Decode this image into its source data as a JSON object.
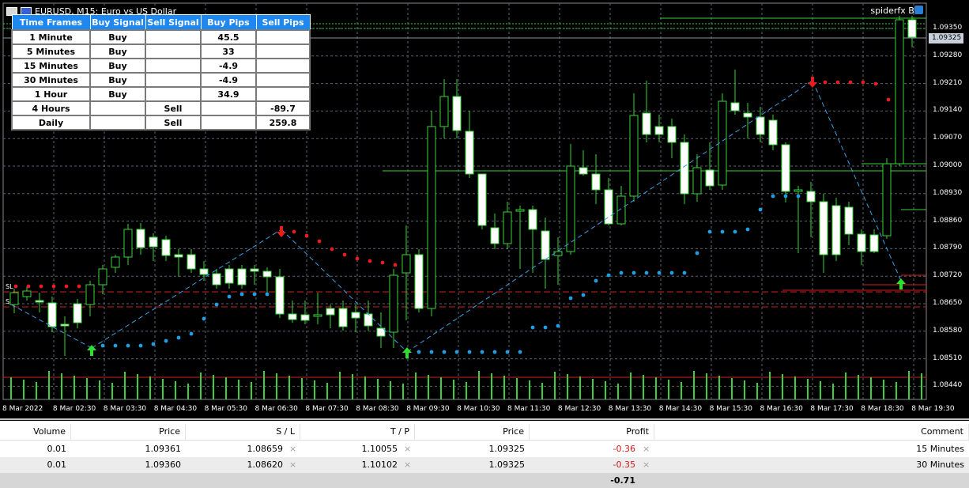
{
  "window": {
    "title": "EURUSD, M15:  Euro vs US Dollar",
    "user": "spiderfx BV",
    "icons": [
      "table-icon",
      "flag-icon",
      "user-icon"
    ]
  },
  "signal_table": {
    "headers": [
      "Time Frames",
      "Buy Signal",
      "Sell Signal",
      "Buy Pips",
      "Sell Pips"
    ],
    "rows": [
      [
        "1 Minute",
        "Buy",
        "",
        "45.5",
        ""
      ],
      [
        "5 Minutes",
        "Buy",
        "",
        "33",
        ""
      ],
      [
        "15 Minutes",
        "Buy",
        "",
        "-4.9",
        ""
      ],
      [
        "30 Minutes",
        "Buy",
        "",
        "-4.9",
        ""
      ],
      [
        "1 Hour",
        "Buy",
        "",
        "34.9",
        ""
      ],
      [
        "4 Hours",
        "",
        "Sell",
        "",
        "-89.7"
      ],
      [
        "Daily",
        "",
        "Sell",
        "",
        "259.8"
      ]
    ]
  },
  "chart_data": {
    "type": "candlestick",
    "symbol": "EURUSD",
    "timeframe": "M15",
    "ylim": [
      1.084,
      1.097
    ],
    "price_ticks": [
      "1.09350",
      "1.09280",
      "1.09210",
      "1.09140",
      "1.09070",
      "1.09000",
      "1.08930",
      "1.08860",
      "1.08790",
      "1.08720",
      "1.08650",
      "1.08580",
      "1.08510",
      "1.08440"
    ],
    "current_price": "1.09325",
    "time_ticks": [
      "8 Mar 2022",
      "8 Mar 02:30",
      "8 Mar 03:30",
      "8 Mar 04:30",
      "8 Mar 05:30",
      "8 Mar 06:30",
      "8 Mar 07:30",
      "8 Mar 08:30",
      "8 Mar 09:30",
      "8 Mar 10:30",
      "8 Mar 11:30",
      "8 Mar 12:30",
      "8 Mar 13:30",
      "8 Mar 14:30",
      "8 Mar 15:30",
      "8 Mar 16:30",
      "8 Mar 17:30",
      "8 Mar 18:30",
      "8 Mar 19:30"
    ],
    "markers": [
      "SL",
      "S"
    ],
    "colors": {
      "background": "#000000",
      "candle_outline": "#39d339",
      "bull_body": "#000000",
      "bear_body": "#ffffff",
      "grid": "#5a6270",
      "volume": "#39d339",
      "trend_dots_up": "#1ea0e6",
      "trend_dots_down": "#e61e1e",
      "signal_up": "#2ee02e",
      "signal_down": "#e61e1e",
      "trade_line": "#3aa0e6",
      "level_green": "#3cd03c",
      "level_red": "#d01e1e"
    }
  },
  "trade_panel": {
    "headers": {
      "volume": "Volume",
      "price": "Price",
      "sl": "S / L",
      "tp": "T / P",
      "current": "Price",
      "profit": "Profit",
      "comment": "Comment"
    },
    "rows": [
      {
        "volume": "0.01",
        "price": "1.09361",
        "sl": "1.08659",
        "tp": "1.10055",
        "current": "1.09325",
        "profit": "-0.36",
        "comment": "15 Minutes"
      },
      {
        "volume": "0.01",
        "price": "1.09360",
        "sl": "1.08620",
        "tp": "1.10102",
        "current": "1.09325",
        "profit": "-0.35",
        "comment": "30 Minutes"
      }
    ],
    "total_profit": "-0.71",
    "close_icon": "×"
  }
}
